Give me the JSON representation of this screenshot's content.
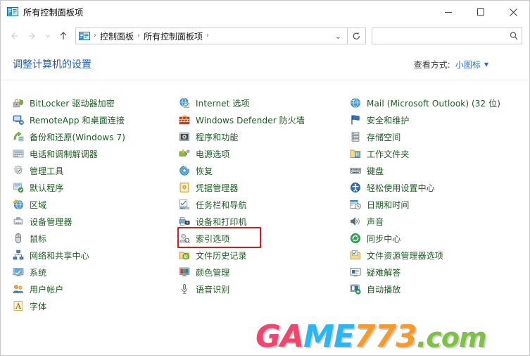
{
  "window": {
    "title": "所有控制面板项",
    "title_icon": "control-panel-icon",
    "controls": {
      "minimize": "最小化",
      "maximize": "最大化",
      "close": "关闭"
    }
  },
  "navbar": {
    "back": "后退",
    "forward": "前进",
    "recent": "最近浏览的位置",
    "up": "上移到",
    "breadcrumb": {
      "icon": "control-panel-icon",
      "items": [
        "控制面板",
        "所有控制面板项"
      ],
      "separator": "›"
    },
    "dropdown_caret": "⌄",
    "refresh": "刷新",
    "search": {
      "value": "",
      "placeholder": "",
      "icon": "search-icon"
    }
  },
  "header": {
    "page_title": "调整计算机的设置",
    "view_label": "查看方式:",
    "view_value": "小图标",
    "view_caret": "▼"
  },
  "colors": {
    "item_text": "#1b5e20",
    "link_blue": "#2a6fc9",
    "title_blue": "#1f5fa8",
    "highlight_red": "#ee1111"
  },
  "highlight": {
    "target": "程序和功能",
    "color": "#ee1111"
  },
  "columns": [
    {
      "name": "column-1",
      "items": [
        {
          "label": "BitLocker 驱动器加密",
          "icon": "bitlocker-icon"
        },
        {
          "label": "RemoteApp 和桌面连接",
          "icon": "remoteapp-icon"
        },
        {
          "label": "备份和还原(Windows 7)",
          "icon": "backup-restore-icon"
        },
        {
          "label": "电话和调制解调器",
          "icon": "phone-modem-icon"
        },
        {
          "label": "管理工具",
          "icon": "admin-tools-icon"
        },
        {
          "label": "默认程序",
          "icon": "default-programs-icon"
        },
        {
          "label": "区域",
          "icon": "region-icon"
        },
        {
          "label": "设备管理器",
          "icon": "device-manager-icon"
        },
        {
          "label": "鼠标",
          "icon": "mouse-icon"
        },
        {
          "label": "网络和共享中心",
          "icon": "network-sharing-icon"
        },
        {
          "label": "系统",
          "icon": "system-icon"
        },
        {
          "label": "用户帐户",
          "icon": "user-accounts-icon"
        },
        {
          "label": "字体",
          "icon": "fonts-icon"
        }
      ]
    },
    {
      "name": "column-2",
      "items": [
        {
          "label": "Internet 选项",
          "icon": "internet-options-icon"
        },
        {
          "label": "Windows Defender 防火墙",
          "icon": "firewall-icon"
        },
        {
          "label": "程序和功能",
          "icon": "programs-features-icon"
        },
        {
          "label": "电源选项",
          "icon": "power-options-icon"
        },
        {
          "label": "恢复",
          "icon": "recovery-icon"
        },
        {
          "label": "凭据管理器",
          "icon": "credential-manager-icon"
        },
        {
          "label": "任务栏和导航",
          "icon": "taskbar-navigation-icon"
        },
        {
          "label": "设备和打印机",
          "icon": "devices-printers-icon"
        },
        {
          "label": "索引选项",
          "icon": "indexing-options-icon"
        },
        {
          "label": "文件历史记录",
          "icon": "file-history-icon"
        },
        {
          "label": "颜色管理",
          "icon": "color-management-icon"
        },
        {
          "label": "语音识别",
          "icon": "speech-recognition-icon"
        }
      ]
    },
    {
      "name": "column-3",
      "items": [
        {
          "label": "Mail (Microsoft Outlook) (32 位)",
          "icon": "mail-icon"
        },
        {
          "label": "安全和维护",
          "icon": "security-maintenance-icon"
        },
        {
          "label": "存储空间",
          "icon": "storage-spaces-icon"
        },
        {
          "label": "工作文件夹",
          "icon": "work-folders-icon"
        },
        {
          "label": "键盘",
          "icon": "keyboard-icon"
        },
        {
          "label": "轻松使用设置中心",
          "icon": "ease-of-access-icon"
        },
        {
          "label": "日期和时间",
          "icon": "date-time-icon"
        },
        {
          "label": "声音",
          "icon": "sound-icon"
        },
        {
          "label": "同步中心",
          "icon": "sync-center-icon"
        },
        {
          "label": "文件资源管理器选项",
          "icon": "file-explorer-options-icon"
        },
        {
          "label": "疑难解答",
          "icon": "troubleshooting-icon"
        },
        {
          "label": "自动播放",
          "icon": "autoplay-icon"
        }
      ]
    }
  ],
  "watermark": {
    "part1": "GA",
    "part2": "ME",
    "part3": "773",
    "part4": ".com"
  }
}
